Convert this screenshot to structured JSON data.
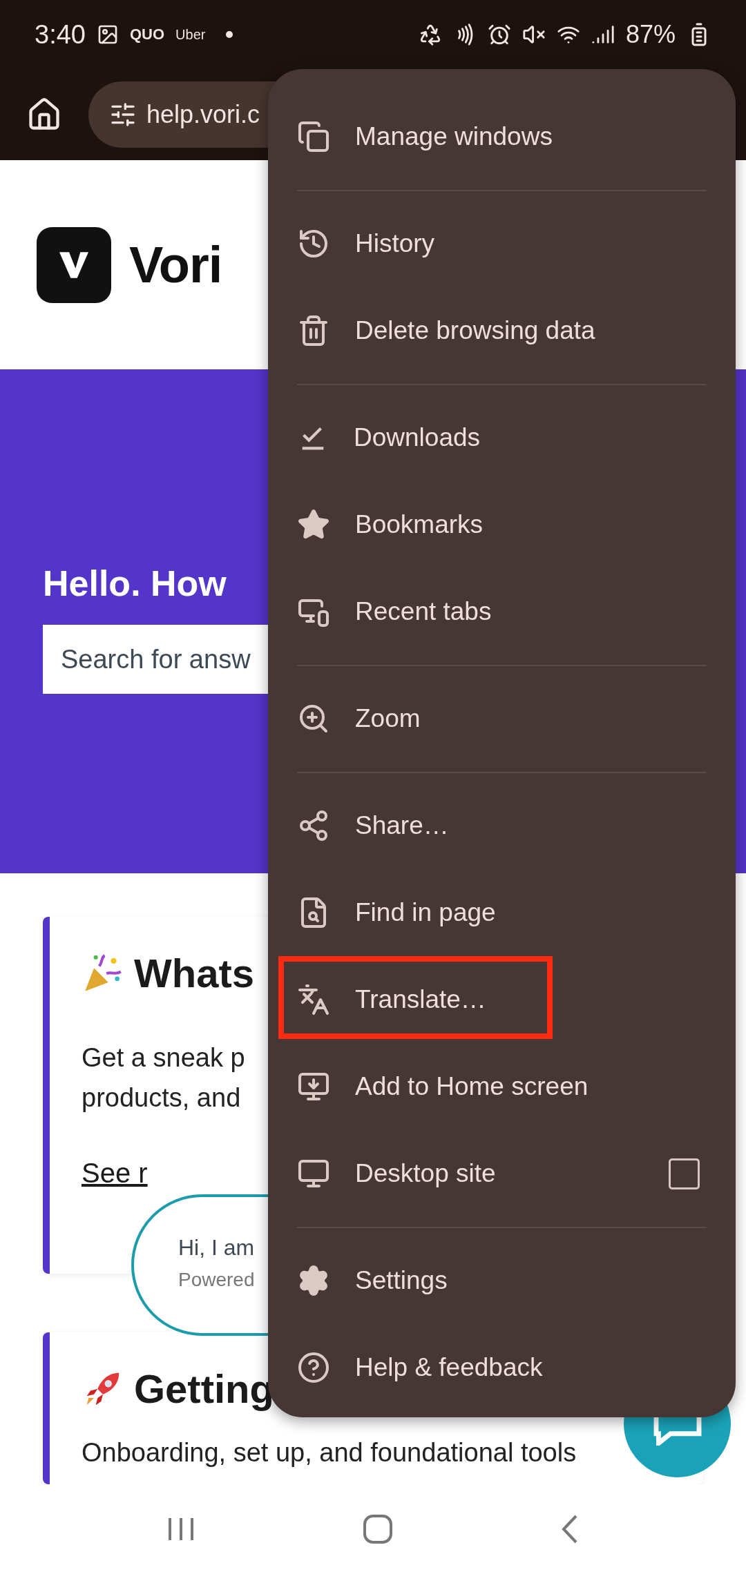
{
  "status_bar": {
    "time": "3:40",
    "apps": [
      "QUO",
      "Uber"
    ],
    "battery": "87%"
  },
  "toolbar": {
    "url": "help.vori.c"
  },
  "header": {
    "logo_text": "Vori"
  },
  "hero": {
    "title": "Hello. How",
    "search": {
      "placeholder": "Search for answ"
    }
  },
  "cards": [
    {
      "title": "Whats",
      "lines": [
        "Get a sneak p",
        "products, and"
      ],
      "link": "See r"
    },
    {
      "title": "Getting",
      "lines": [
        "Onboarding, set up, and foundational tools"
      ]
    }
  ],
  "chat_bubble": {
    "greeting": "Hi, I am",
    "powered": "Powered"
  },
  "menu": {
    "groups": [
      {
        "items": [
          {
            "label": "Manage windows",
            "kind": "plain",
            "highlighted": false
          }
        ]
      },
      {
        "items": [
          {
            "label": "History",
            "kind": "plain",
            "highlighted": false
          },
          {
            "label": "Delete browsing data",
            "kind": "plain",
            "highlighted": false
          }
        ]
      },
      {
        "items": [
          {
            "label": "Downloads",
            "kind": "plain",
            "highlighted": false
          },
          {
            "label": "Bookmarks",
            "kind": "plain",
            "highlighted": false
          },
          {
            "label": "Recent tabs",
            "kind": "plain",
            "highlighted": false
          }
        ]
      },
      {
        "items": [
          {
            "label": "Zoom",
            "kind": "plain",
            "highlighted": false
          }
        ]
      },
      {
        "items": [
          {
            "label": "Share…",
            "kind": "plain",
            "highlighted": false
          },
          {
            "label": "Find in page",
            "kind": "plain",
            "highlighted": false
          },
          {
            "label": "Translate…",
            "kind": "plain",
            "highlighted": true
          },
          {
            "label": "Add to Home screen",
            "kind": "plain",
            "highlighted": false
          },
          {
            "label": "Desktop site",
            "kind": "checkbox",
            "checked": false,
            "highlighted": false
          }
        ]
      },
      {
        "items": [
          {
            "label": "Settings",
            "kind": "plain",
            "highlighted": false
          },
          {
            "label": "Help & feedback",
            "kind": "plain",
            "highlighted": false
          }
        ]
      }
    ]
  }
}
